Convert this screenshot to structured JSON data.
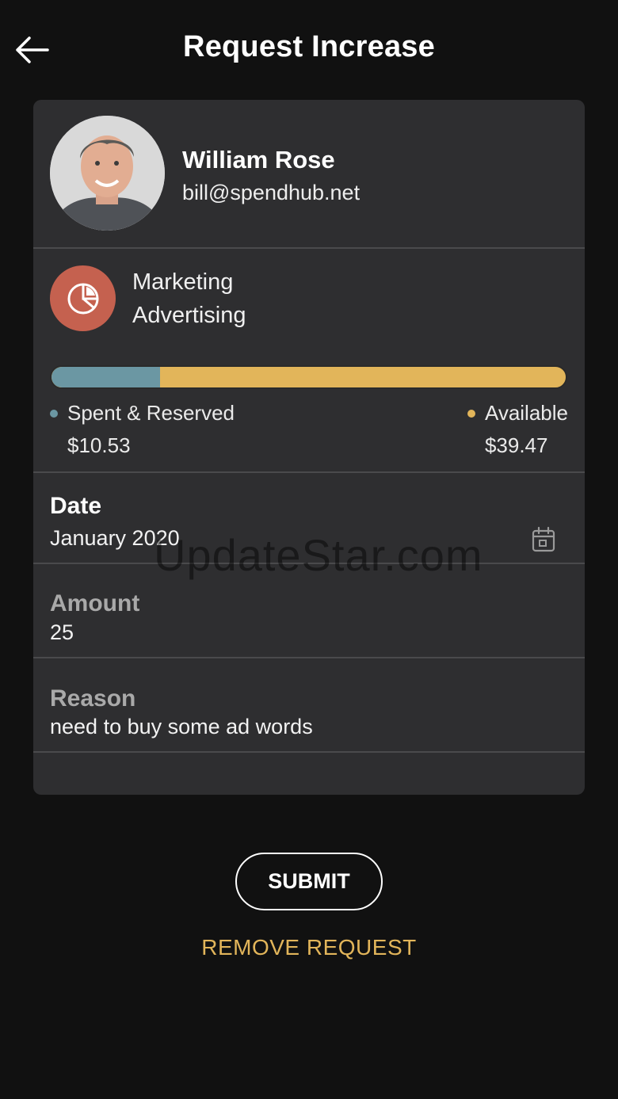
{
  "header": {
    "title": "Request Increase",
    "back_icon": "arrow-left-icon"
  },
  "user": {
    "name": "William Rose",
    "email": "bill@spendhub.net"
  },
  "category": {
    "icon": "pie-chart-icon",
    "icon_color": "#c5614f",
    "line1": "Marketing",
    "line2": "Advertising"
  },
  "budget": {
    "spent_fraction": 0.211,
    "spent_color": "#6b97a3",
    "available_color": "#e2b55a",
    "spent_label": "Spent & Reserved",
    "spent_amount": "$10.53",
    "available_label": "Available",
    "available_amount": "$39.47"
  },
  "date": {
    "label": "Date",
    "value": "January 2020",
    "icon": "calendar-icon"
  },
  "amount": {
    "label": "Amount",
    "value": "25"
  },
  "reason": {
    "label": "Reason",
    "value": "need to buy some ad words"
  },
  "actions": {
    "submit_label": "SUBMIT",
    "remove_label": "REMOVE REQUEST"
  },
  "watermark": "UpdateStar.com"
}
